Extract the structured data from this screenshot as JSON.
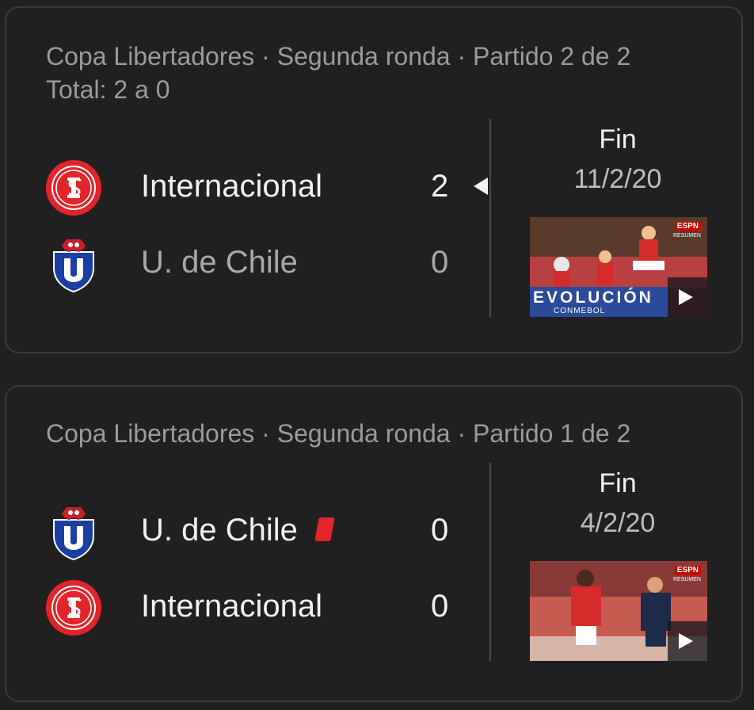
{
  "matches": [
    {
      "header_line1": "Copa Libertadores · Segunda ronda · Partido 2 de 2",
      "header_line2": "Total: 2 a 0",
      "home": {
        "name": "Internacional",
        "score": "2",
        "crest": "internacional-crest-icon"
      },
      "away": {
        "name": "U. de Chile",
        "score": "0",
        "crest": "u-de-chile-crest-icon"
      },
      "status": "Fin",
      "date": "11/2/20",
      "video": {
        "espn": "ESPN",
        "espn_sub": "RESUMEN",
        "banner": "EVOLUCIÓN",
        "banner_sub": "CONMEBOL"
      }
    },
    {
      "header_line1": "Copa Libertadores · Segunda ronda · Partido 1 de 2",
      "home": {
        "name": "U. de Chile",
        "score": "0",
        "crest": "u-de-chile-crest-icon",
        "red_cards": 1
      },
      "away": {
        "name": "Internacional",
        "score": "0",
        "crest": "internacional-crest-icon"
      },
      "status": "Fin",
      "date": "4/2/20",
      "video": {
        "espn": "ESPN",
        "espn_sub": "RESUMEN"
      }
    }
  ],
  "colors": {
    "background": "#202020",
    "internacional_red": "#e3242b",
    "uchile_blue": "#1a3fa0",
    "text_primary": "#f1f1f1",
    "text_secondary": "#9b9b9b"
  }
}
